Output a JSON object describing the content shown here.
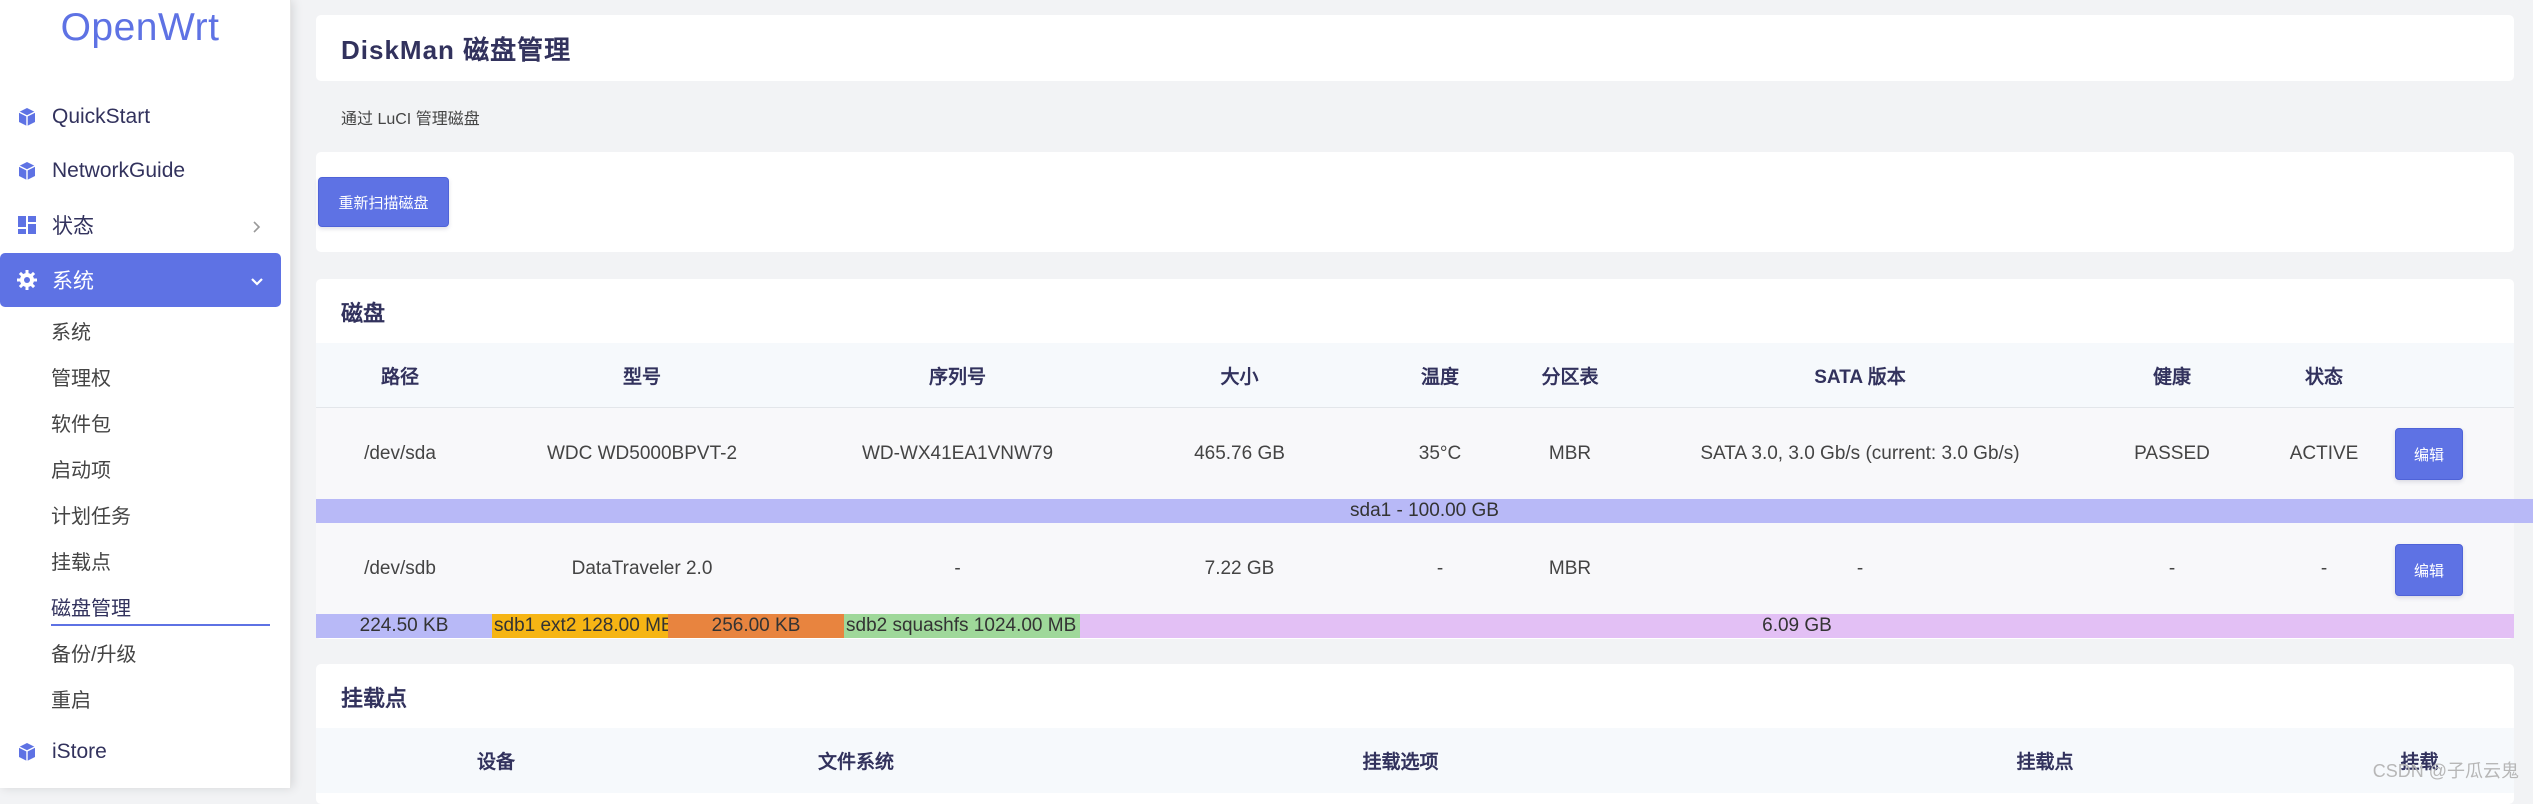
{
  "brand": "OpenWrt",
  "nav": {
    "quickstart": "QuickStart",
    "networkguide": "NetworkGuide",
    "status": "状态",
    "system": "系统",
    "istore": "iStore"
  },
  "submenu": [
    "系统",
    "管理权",
    "软件包",
    "启动项",
    "计划任务",
    "挂载点",
    "磁盘管理",
    "备份/升级",
    "重启"
  ],
  "page": {
    "title": "DiskMan 磁盘管理",
    "description": "通过 LuCI 管理磁盘",
    "rescan_button": "重新扫描磁盘"
  },
  "disks": {
    "section_title": "磁盘",
    "headers": [
      "路径",
      "型号",
      "序列号",
      "大小",
      "温度",
      "分区表",
      "SATA 版本",
      "健康",
      "状态"
    ],
    "edit_label": "编辑",
    "rows": [
      {
        "path": "/dev/sda",
        "model": "WDC WD5000BPVT-2",
        "serial": "WD-WX41EA1VNW79",
        "size": "465.76 GB",
        "temp": "35°C",
        "ptable": "MBR",
        "sata": "SATA 3.0, 3.0 Gb/s (current: 3.0 Gb/s)",
        "health": "PASSED",
        "status": "ACTIVE"
      },
      {
        "path": "/dev/sdb",
        "model": "DataTraveler 2.0",
        "serial": "-",
        "size": "7.22 GB",
        "temp": "-",
        "ptable": "MBR",
        "sata": "-",
        "health": "-",
        "status": "-"
      }
    ],
    "sda_partitions": [
      {
        "label": "sda1 - 100.00 GB",
        "color": "#b8b9f7"
      }
    ],
    "sdb_partitions": [
      {
        "label": "224.50 KB",
        "color": "#b8b9f7"
      },
      {
        "label": "sdb1 ext2 128.00 MB",
        "color": "#f6b514"
      },
      {
        "label": "256.00 KB",
        "color": "#e8843f"
      },
      {
        "label": "sdb2 squashfs 1024.00 MB",
        "color": "#9fd89a"
      },
      {
        "label": "6.09 GB",
        "color": "#e3c0f5"
      }
    ]
  },
  "mounts": {
    "section_title": "挂载点",
    "headers": [
      "设备",
      "文件系统",
      "挂载选项",
      "挂载点",
      "挂载"
    ]
  },
  "watermark": "CSDN @子瓜云鬼",
  "colors": {
    "accent": "#5e72e4",
    "title": "#32325d"
  }
}
